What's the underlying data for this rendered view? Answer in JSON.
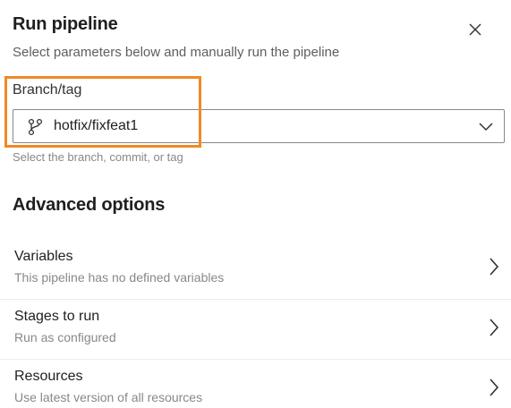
{
  "header": {
    "title": "Run pipeline",
    "subtitle": "Select parameters below and manually run the pipeline",
    "close_icon": "close-icon"
  },
  "branch": {
    "label": "Branch/tag",
    "value": "hotfix/fixfeat1",
    "helper": "Select the branch, commit, or tag",
    "icon": "git-branch-icon",
    "dropdown_icon": "chevron-down-icon"
  },
  "advanced": {
    "title": "Advanced options",
    "items": [
      {
        "title": "Variables",
        "subtitle": "This pipeline has no defined variables"
      },
      {
        "title": "Stages to run",
        "subtitle": "Run as configured"
      },
      {
        "title": "Resources",
        "subtitle": "Use latest version of all resources"
      }
    ]
  },
  "colors": {
    "highlight": "#f08a24",
    "text_primary": "#201f1e",
    "text_secondary": "#605e5c",
    "text_muted": "#8a8886"
  }
}
